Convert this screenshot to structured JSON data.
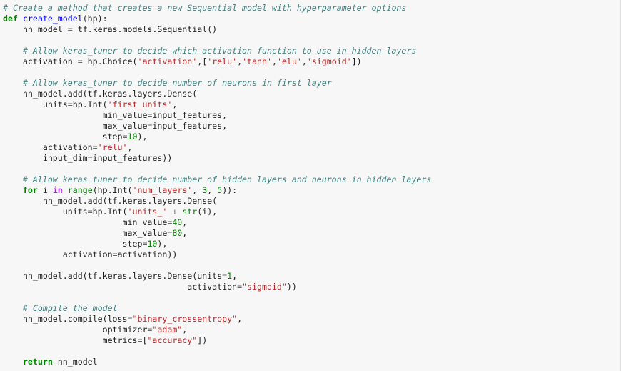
{
  "editor": {
    "language": "python",
    "lines": [
      [
        {
          "t": "c",
          "v": "# Create a method that creates a new Sequential model with hyperparameter options"
        }
      ],
      [
        {
          "t": "k",
          "v": "def"
        },
        {
          "t": "p",
          "v": " "
        },
        {
          "t": "nf",
          "v": "create_model"
        },
        {
          "t": "p",
          "v": "(hp):"
        }
      ],
      [
        {
          "t": "p",
          "v": "    nn_model "
        },
        {
          "t": "o",
          "v": "="
        },
        {
          "t": "p",
          "v": " tf.keras.models.Sequential()"
        }
      ],
      [
        {
          "t": "p",
          "v": ""
        }
      ],
      [
        {
          "t": "p",
          "v": "    "
        },
        {
          "t": "c",
          "v": "# Allow keras_tuner to decide which activation function to use in hidden layers"
        }
      ],
      [
        {
          "t": "p",
          "v": "    activation "
        },
        {
          "t": "o",
          "v": "="
        },
        {
          "t": "p",
          "v": " hp.Choice("
        },
        {
          "t": "s",
          "v": "'activation'"
        },
        {
          "t": "p",
          "v": ",["
        },
        {
          "t": "s",
          "v": "'relu'"
        },
        {
          "t": "p",
          "v": ","
        },
        {
          "t": "s",
          "v": "'tanh'"
        },
        {
          "t": "p",
          "v": ","
        },
        {
          "t": "s",
          "v": "'elu'"
        },
        {
          "t": "p",
          "v": ","
        },
        {
          "t": "s",
          "v": "'sigmoid'"
        },
        {
          "t": "p",
          "v": "])"
        }
      ],
      [
        {
          "t": "p",
          "v": ""
        }
      ],
      [
        {
          "t": "p",
          "v": "    "
        },
        {
          "t": "c",
          "v": "# Allow keras_tuner to decide number of neurons in first layer"
        }
      ],
      [
        {
          "t": "p",
          "v": "    nn_model.add(tf.keras.layers.Dense("
        }
      ],
      [
        {
          "t": "p",
          "v": "        units"
        },
        {
          "t": "o",
          "v": "="
        },
        {
          "t": "p",
          "v": "hp.Int("
        },
        {
          "t": "s",
          "v": "'first_units'"
        },
        {
          "t": "p",
          "v": ","
        }
      ],
      [
        {
          "t": "p",
          "v": "                    min_value"
        },
        {
          "t": "o",
          "v": "="
        },
        {
          "t": "p",
          "v": "input_features,"
        }
      ],
      [
        {
          "t": "p",
          "v": "                    max_value"
        },
        {
          "t": "o",
          "v": "="
        },
        {
          "t": "p",
          "v": "input_features,"
        }
      ],
      [
        {
          "t": "p",
          "v": "                    step"
        },
        {
          "t": "o",
          "v": "="
        },
        {
          "t": "m",
          "v": "10"
        },
        {
          "t": "p",
          "v": "),"
        }
      ],
      [
        {
          "t": "p",
          "v": "        activation"
        },
        {
          "t": "o",
          "v": "="
        },
        {
          "t": "s",
          "v": "'relu'"
        },
        {
          "t": "p",
          "v": ","
        }
      ],
      [
        {
          "t": "p",
          "v": "        input_dim"
        },
        {
          "t": "o",
          "v": "="
        },
        {
          "t": "p",
          "v": "input_features))"
        }
      ],
      [
        {
          "t": "p",
          "v": ""
        }
      ],
      [
        {
          "t": "p",
          "v": "    "
        },
        {
          "t": "c",
          "v": "# Allow keras_tuner to decide number of hidden layers and neurons in hidden layers"
        }
      ],
      [
        {
          "t": "p",
          "v": "    "
        },
        {
          "t": "k",
          "v": "for"
        },
        {
          "t": "p",
          "v": " i "
        },
        {
          "t": "ow",
          "v": "in"
        },
        {
          "t": "p",
          "v": " "
        },
        {
          "t": "bi",
          "v": "range"
        },
        {
          "t": "p",
          "v": "(hp.Int("
        },
        {
          "t": "s",
          "v": "'num_layers'"
        },
        {
          "t": "p",
          "v": ", "
        },
        {
          "t": "m",
          "v": "3"
        },
        {
          "t": "p",
          "v": ", "
        },
        {
          "t": "m",
          "v": "5"
        },
        {
          "t": "p",
          "v": ")):"
        }
      ],
      [
        {
          "t": "p",
          "v": "        nn_model.add(tf.keras.layers.Dense("
        }
      ],
      [
        {
          "t": "p",
          "v": "            units"
        },
        {
          "t": "o",
          "v": "="
        },
        {
          "t": "p",
          "v": "hp.Int("
        },
        {
          "t": "s",
          "v": "'units_'"
        },
        {
          "t": "p",
          "v": " "
        },
        {
          "t": "o",
          "v": "+"
        },
        {
          "t": "p",
          "v": " "
        },
        {
          "t": "bi",
          "v": "str"
        },
        {
          "t": "p",
          "v": "(i),"
        }
      ],
      [
        {
          "t": "p",
          "v": "                        min_value"
        },
        {
          "t": "o",
          "v": "="
        },
        {
          "t": "m",
          "v": "40"
        },
        {
          "t": "p",
          "v": ","
        }
      ],
      [
        {
          "t": "p",
          "v": "                        max_value"
        },
        {
          "t": "o",
          "v": "="
        },
        {
          "t": "m",
          "v": "80"
        },
        {
          "t": "p",
          "v": ","
        }
      ],
      [
        {
          "t": "p",
          "v": "                        step"
        },
        {
          "t": "o",
          "v": "="
        },
        {
          "t": "m",
          "v": "10"
        },
        {
          "t": "p",
          "v": "),"
        }
      ],
      [
        {
          "t": "p",
          "v": "            activation"
        },
        {
          "t": "o",
          "v": "="
        },
        {
          "t": "p",
          "v": "activation))"
        }
      ],
      [
        {
          "t": "p",
          "v": ""
        }
      ],
      [
        {
          "t": "p",
          "v": "    nn_model.add(tf.keras.layers.Dense(units"
        },
        {
          "t": "o",
          "v": "="
        },
        {
          "t": "m",
          "v": "1"
        },
        {
          "t": "p",
          "v": ","
        }
      ],
      [
        {
          "t": "p",
          "v": "                                     activation"
        },
        {
          "t": "o",
          "v": "="
        },
        {
          "t": "s",
          "v": "\"sigmoid\""
        },
        {
          "t": "p",
          "v": "))"
        }
      ],
      [
        {
          "t": "p",
          "v": ""
        }
      ],
      [
        {
          "t": "p",
          "v": "    "
        },
        {
          "t": "c",
          "v": "# Compile the model"
        }
      ],
      [
        {
          "t": "p",
          "v": "    nn_model.compile(loss"
        },
        {
          "t": "o",
          "v": "="
        },
        {
          "t": "s",
          "v": "\"binary_crossentropy\""
        },
        {
          "t": "p",
          "v": ","
        }
      ],
      [
        {
          "t": "p",
          "v": "                    optimizer"
        },
        {
          "t": "o",
          "v": "="
        },
        {
          "t": "s",
          "v": "\"adam\""
        },
        {
          "t": "p",
          "v": ","
        }
      ],
      [
        {
          "t": "p",
          "v": "                    metrics"
        },
        {
          "t": "o",
          "v": "="
        },
        {
          "t": "p",
          "v": "["
        },
        {
          "t": "s",
          "v": "\"accuracy\""
        },
        {
          "t": "p",
          "v": "])"
        }
      ],
      [
        {
          "t": "p",
          "v": ""
        }
      ],
      [
        {
          "t": "p",
          "v": "    "
        },
        {
          "t": "k",
          "v": "return"
        },
        {
          "t": "p",
          "v": " nn_model"
        }
      ]
    ]
  },
  "colors": {
    "background": "#f7f7f7",
    "comment": "#408080",
    "keyword": "#008000",
    "string": "#ba2121",
    "function_name": "#0000ff",
    "number": "#008000",
    "operator": "#666666"
  }
}
